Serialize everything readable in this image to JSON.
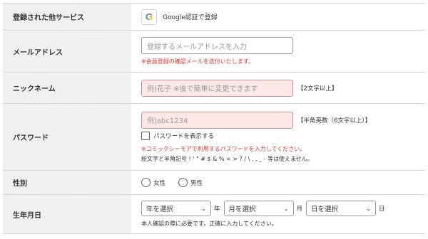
{
  "rows": [
    {
      "label": "登録された他サービス"
    },
    {
      "label": "メールアドレス"
    },
    {
      "label": "ニックネーム"
    },
    {
      "label": "パスワード"
    },
    {
      "label": "性別"
    },
    {
      "label": "生年月日"
    }
  ],
  "google": {
    "icon": "google-icon",
    "icon_glyph": "G",
    "label": "Google認証で登録"
  },
  "email": {
    "placeholder": "登録するメールアドレスを入力",
    "note": "※会員登録の確認メールを送付いたします。"
  },
  "nickname": {
    "placeholder": "例)花子 ※後で簡単に変更できます",
    "hint": "【2文字以上】"
  },
  "password": {
    "placeholder": "例)abc1234",
    "hint": "【半角英数（6文字以上）】",
    "show_label": "パスワードを表示する",
    "warn": "※コミックシーモアで利用するパスワードを入力してください。",
    "note": "絵文字と半角記号 ! ' \" # $ & % < > ? / \\ . , _ - 等は使えません。"
  },
  "gender": {
    "options": [
      "女性",
      "男性"
    ]
  },
  "birthday": {
    "year": {
      "value": "年を選択",
      "unit": "年"
    },
    "month": {
      "value": "月を選択",
      "unit": "月"
    },
    "day": {
      "value": "日を選択",
      "unit": "日"
    },
    "note": "本人確認の際に必要です。正確に入力してください。"
  },
  "colors": {
    "warning": "#e0352b",
    "pink_field": "#fde8e8",
    "label_bg": "#f3f3f3"
  }
}
